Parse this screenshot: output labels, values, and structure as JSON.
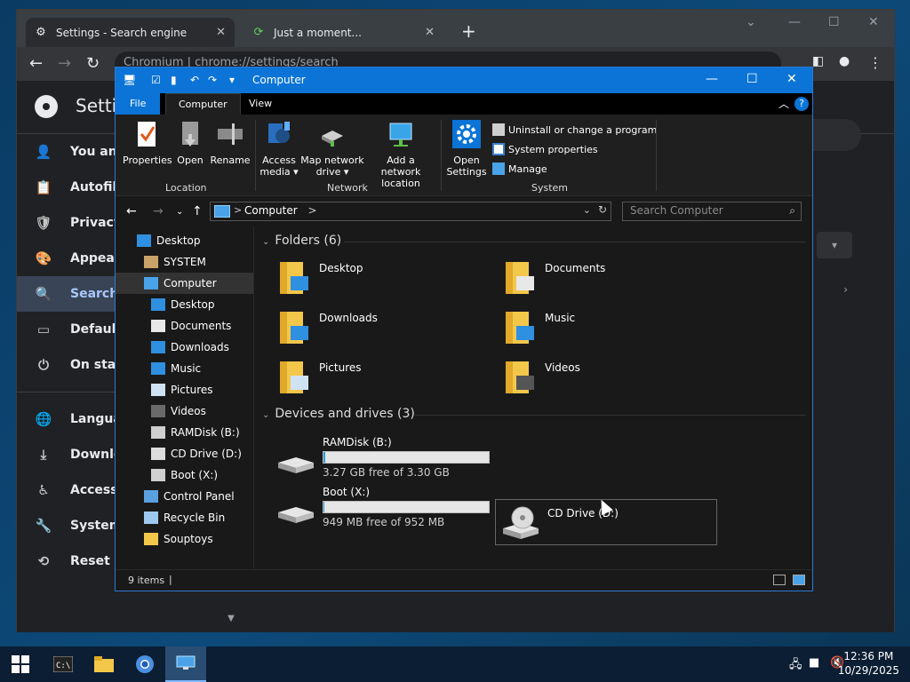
{
  "browser": {
    "tabs": [
      {
        "title": "Settings - Search engine",
        "active": true
      },
      {
        "title": "Just a moment...",
        "active": false
      }
    ],
    "new_tab": "+",
    "omnibox": "Chromium  |  chrome://settings/search",
    "settings_title": "Setti",
    "sidebar": [
      {
        "label": "You and",
        "icon": "person-icon"
      },
      {
        "label": "Autofill",
        "icon": "clipboard-icon"
      },
      {
        "label": "Privacy",
        "icon": "shield-icon"
      },
      {
        "label": "Appeara",
        "icon": "palette-icon"
      },
      {
        "label": "Search",
        "icon": "search-icon",
        "active": true
      },
      {
        "label": "Default",
        "icon": "browser-icon"
      },
      {
        "label": "On star",
        "icon": "power-icon"
      },
      {
        "label": "Langua",
        "icon": "globe-icon"
      },
      {
        "label": "Downlo",
        "icon": "download-icon"
      },
      {
        "label": "Access",
        "icon": "accessibility-icon"
      },
      {
        "label": "System",
        "icon": "wrench-icon"
      },
      {
        "label": "Reset s",
        "icon": "history-icon"
      }
    ]
  },
  "explorer": {
    "title": "Computer",
    "ribbon_tabs": {
      "file": "File",
      "computer": "Computer",
      "view": "View"
    },
    "help": "?",
    "ribbon": {
      "location": {
        "label": "Location",
        "buttons": [
          "Properties",
          "Open",
          "Rename"
        ]
      },
      "network": {
        "label": "Network",
        "access_media": [
          "Access",
          "media ▾"
        ],
        "map_drive": [
          "Map network",
          "drive ▾"
        ],
        "add_location": [
          "Add a network",
          "location"
        ]
      },
      "system": {
        "label": "System",
        "open_settings": [
          "Open",
          "Settings"
        ],
        "uninstall": "Uninstall or change a program",
        "system_properties": "System properties",
        "manage": "Manage"
      }
    },
    "address": {
      "path": "Computer",
      "sep": ">",
      "search_placeholder": "Search Computer"
    },
    "nav": [
      {
        "label": "Desktop",
        "indent": 0,
        "icon": "desktop-icon"
      },
      {
        "label": "SYSTEM",
        "indent": 1,
        "icon": "user-icon"
      },
      {
        "label": "Computer",
        "indent": 1,
        "icon": "computer-icon",
        "selected": true
      },
      {
        "label": "Desktop",
        "indent": 2,
        "icon": "desktop-icon"
      },
      {
        "label": "Documents",
        "indent": 2,
        "icon": "documents-icon"
      },
      {
        "label": "Downloads",
        "indent": 2,
        "icon": "downloads-icon"
      },
      {
        "label": "Music",
        "indent": 2,
        "icon": "music-icon"
      },
      {
        "label": "Pictures",
        "indent": 2,
        "icon": "pictures-icon"
      },
      {
        "label": "Videos",
        "indent": 2,
        "icon": "videos-icon"
      },
      {
        "label": "RAMDisk (B:)",
        "indent": 2,
        "icon": "drive-icon"
      },
      {
        "label": "CD Drive (D:)",
        "indent": 2,
        "icon": "cd-icon"
      },
      {
        "label": "Boot (X:)",
        "indent": 2,
        "icon": "drive-icon"
      },
      {
        "label": "Control Panel",
        "indent": 1,
        "icon": "control-panel-icon"
      },
      {
        "label": "Recycle Bin",
        "indent": 1,
        "icon": "recycle-bin-icon"
      },
      {
        "label": "Souptoys",
        "indent": 1,
        "icon": "folder-icon"
      }
    ],
    "folders_header": "Folders (6)",
    "folders": [
      "Desktop",
      "Documents",
      "Downloads",
      "Music",
      "Pictures",
      "Videos"
    ],
    "drives_header": "Devices and drives (3)",
    "drives": [
      {
        "name": "RAMDisk (B:)",
        "free": "3.27 GB free of 3.30 GB",
        "used_fraction": 0.01
      },
      {
        "name": "Boot (X:)",
        "free": "949 MB free of 952 MB",
        "used_fraction": 0.003
      }
    ],
    "cd_drive": "CD Drive (D:)",
    "status": "9 items"
  },
  "taskbar": {
    "time": "12:36 PM",
    "date": "10/29/2025"
  },
  "colors": {
    "accent": "#0b74d6",
    "selected_sidebar": "#394457"
  }
}
